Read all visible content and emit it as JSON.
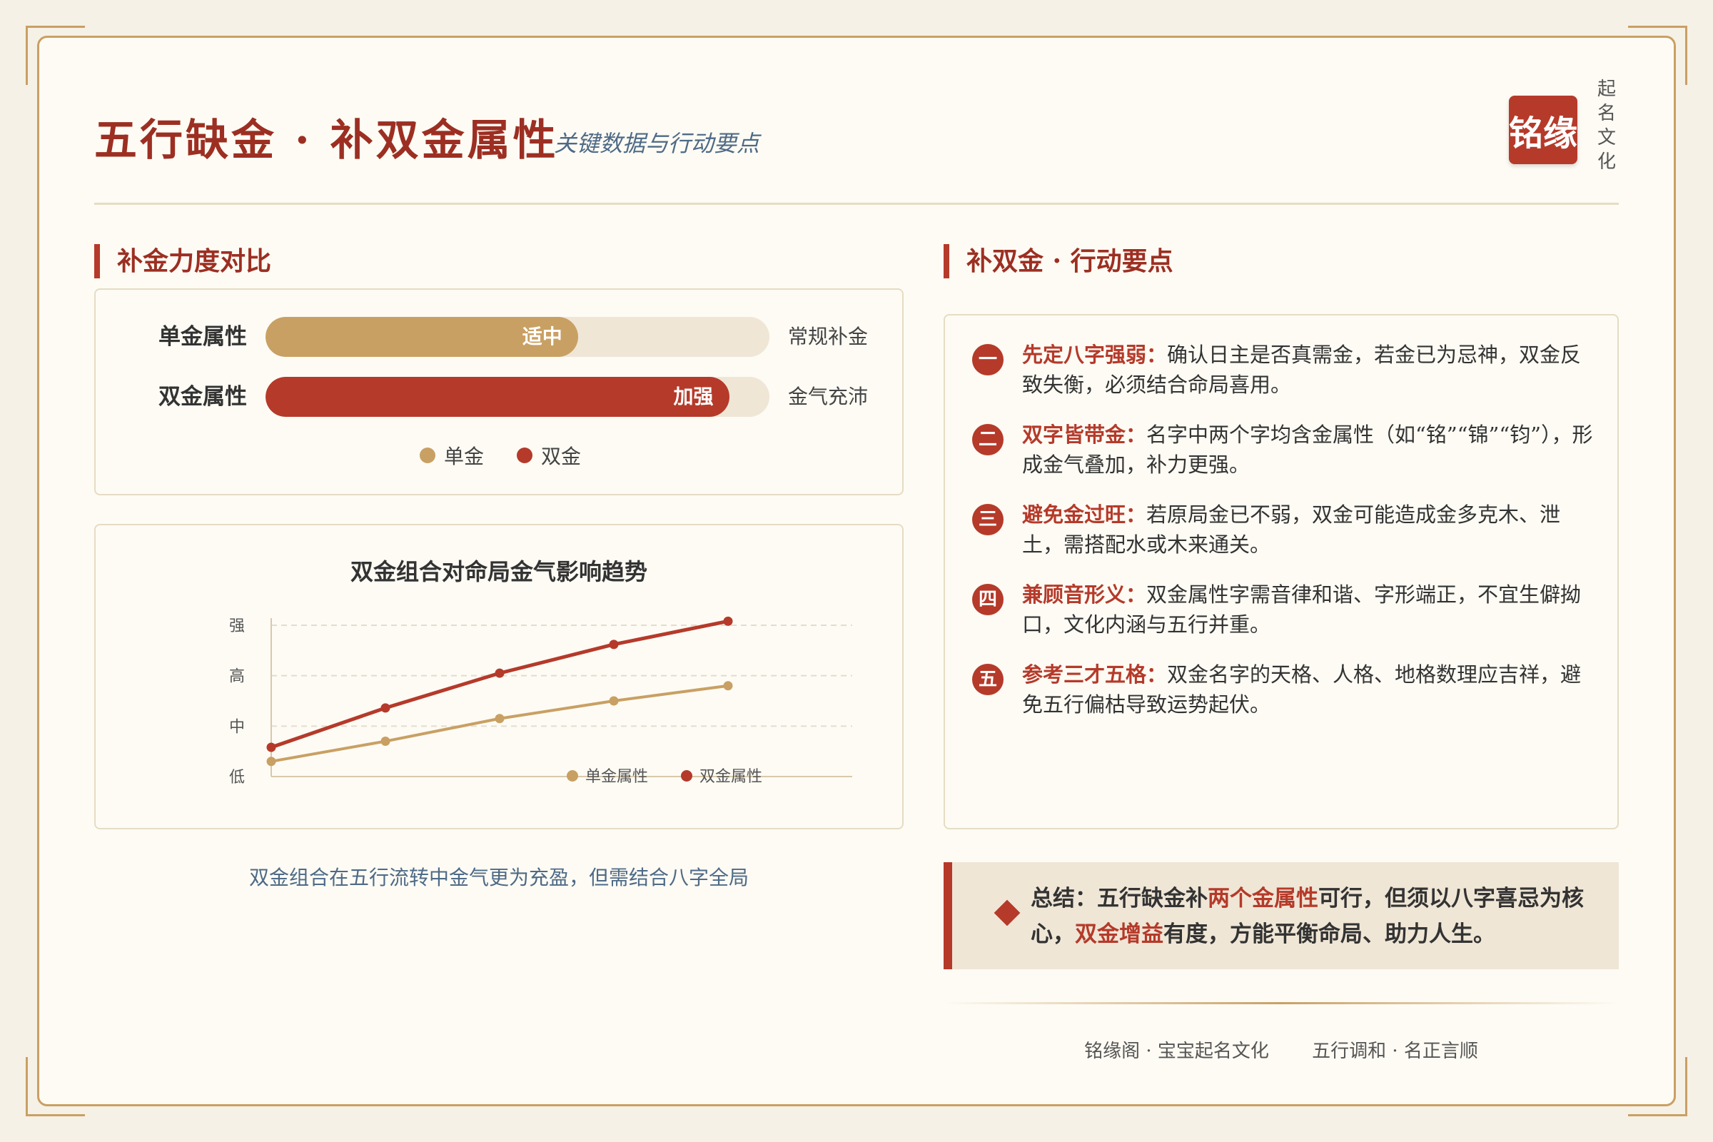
{
  "header": {
    "title": "五行缺金 · 补双金属性",
    "subtitle": "关键数据与行动要点",
    "brand_seal": "铭缘",
    "brand_side": "起名文化"
  },
  "left": {
    "section_title": "补金力度对比",
    "bars": [
      {
        "label": "单金属性",
        "value_text": "适中",
        "note": "常规补金",
        "fill_pct": 62,
        "color": "#c9a063"
      },
      {
        "label": "双金属性",
        "value_text": "加强",
        "note": "金气充沛",
        "fill_pct": 92,
        "color": "#b53a2a"
      }
    ],
    "legend": [
      {
        "label": "单金",
        "color": "#c9a063"
      },
      {
        "label": "双金",
        "color": "#b53a2a"
      }
    ],
    "caption": "双金组合在五行流转中金气更为充盈，但需结合八字全局"
  },
  "chart_data": {
    "type": "line",
    "title": "双金组合对命局金气影响趋势",
    "y_ticks": [
      "低",
      "中",
      "高",
      "强"
    ],
    "ylim": [
      0,
      3
    ],
    "x": [
      1,
      2,
      3,
      4,
      5
    ],
    "series": [
      {
        "name": "单金属性",
        "color": "#c9a063",
        "values": [
          0.3,
          0.7,
          1.15,
          1.5,
          1.8
        ]
      },
      {
        "name": "双金属性",
        "color": "#b53a2a",
        "values": [
          0.58,
          1.36,
          2.05,
          2.62,
          3.08
        ]
      }
    ],
    "grid": true,
    "legend_position": "bottom-right"
  },
  "right": {
    "section_title": "补双金 · 行动要点",
    "steps": [
      {
        "num": "一",
        "head": "先定八字强弱：",
        "body": "确认日主是否真需金，若金已为忌神，双金反致失衡，必须结合命局喜用。"
      },
      {
        "num": "二",
        "head": "双字皆带金：",
        "body": "名字中两个字均含金属性（如“铭”“锦”“钧”），形成金气叠加，补力更强。"
      },
      {
        "num": "三",
        "head": "避免金过旺：",
        "body": "若原局金已不弱，双金可能造成金多克木、泄土，需搭配水或木来通关。"
      },
      {
        "num": "四",
        "head": "兼顾音形义：",
        "body": "双金属性字需音律和谐、字形端正，不宜生僻拗口，文化内涵与五行并重。"
      },
      {
        "num": "五",
        "head": "参考三才五格：",
        "body": "双金名字的天格、人格、地格数理应吉祥，避免五行偏枯导致运势起伏。"
      }
    ],
    "summary": {
      "prefix": "总结：五行缺金补",
      "hl1": "两个金属性",
      "mid": "可行，但须以八字喜忌为核心，",
      "hl2": "双金增益",
      "suffix": "有度，方能平衡命局、助力人生。"
    }
  },
  "footer": {
    "left": "铭缘阁 · 宝宝起名文化",
    "right": "五行调和 · 名正言顺"
  }
}
